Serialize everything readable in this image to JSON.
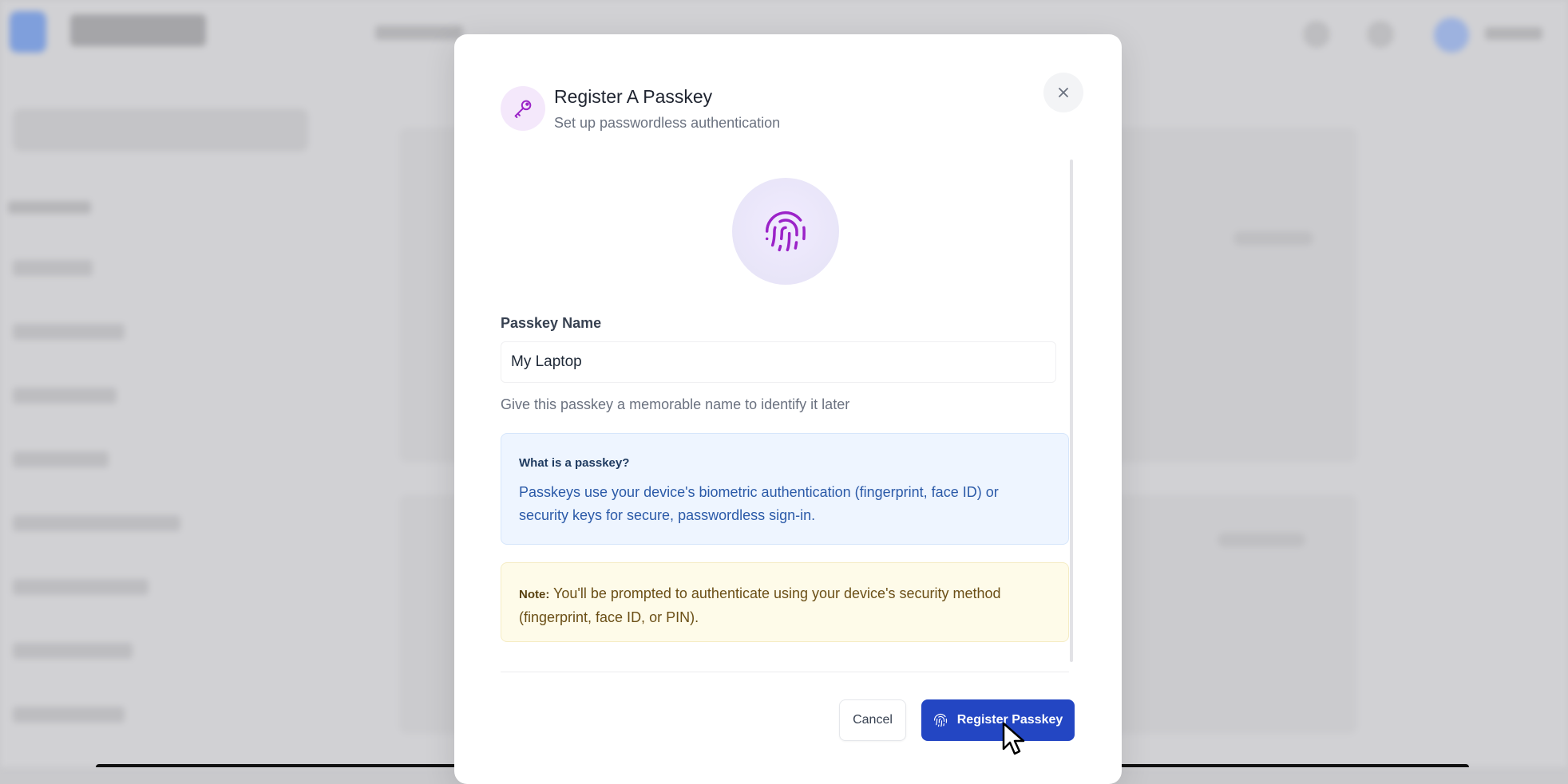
{
  "modal": {
    "title": "Register A Passkey",
    "subtitle": "Set up passwordless authentication",
    "close_icon": "close-icon",
    "header_icon": "key-icon",
    "hero_icon": "fingerprint-icon"
  },
  "form": {
    "name_label": "Passkey Name",
    "name_value": "My Laptop",
    "help_text": "Give this passkey a memorable name to identify it later"
  },
  "info": {
    "title": "What is a passkey?",
    "body": "Passkeys use your device's biometric authentication (fingerprint, face ID) or security keys for secure, passwordless sign-in."
  },
  "note": {
    "label": "Note:",
    "text": "You'll be prompted to authenticate using your device's security method (fingerprint, face ID, or PIN)."
  },
  "actions": {
    "cancel_label": "Cancel",
    "register_label": "Register Passkey"
  },
  "colors": {
    "primary": "#2346c3",
    "accent_purple": "#9b23c8",
    "info_bg": "#eef5ff",
    "note_bg": "#fefbe9"
  }
}
